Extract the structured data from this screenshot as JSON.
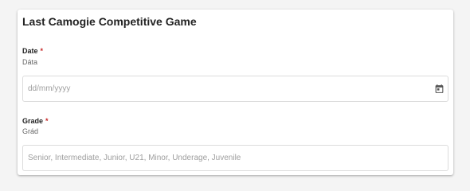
{
  "form": {
    "title": "Last Camogie Competitive Game",
    "required_marker": "*",
    "date": {
      "label": "Date",
      "sublabel": "Dáta",
      "value": "",
      "placeholder": "dd/mm/yyyy",
      "icon": "calendar-icon"
    },
    "grade": {
      "label": "Grade",
      "sublabel": "Grád",
      "value": "",
      "placeholder": "Senior, Intermediate, Junior, U21, Minor, Underage, Juvenile"
    }
  },
  "colors": {
    "required": "#c62828",
    "border": "#dcdcdc",
    "placeholder": "#9e9e9e",
    "text": "#222222"
  }
}
